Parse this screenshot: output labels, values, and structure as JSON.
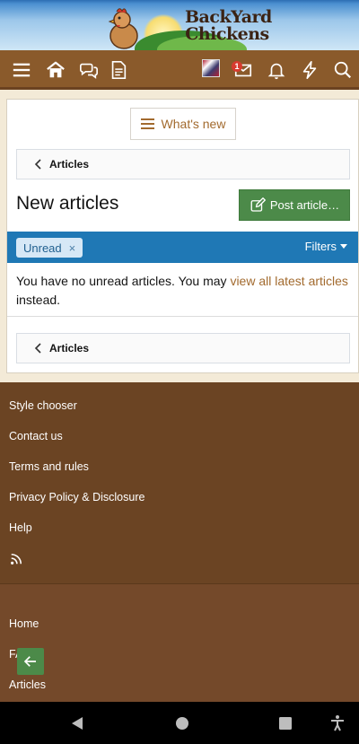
{
  "header": {
    "logo_line1": "BackYard",
    "logo_line2": "Chickens"
  },
  "navbar": {
    "icons": [
      "menu-icon",
      "home-icon",
      "chat-bubbles-icon",
      "document-icon",
      "avatar",
      "inbox-icon",
      "bell-icon",
      "bolt-icon",
      "search-icon"
    ],
    "inbox_badge": "1"
  },
  "main": {
    "whats_new_label": "What's new",
    "breadcrumb_top": "Articles",
    "page_title": "New articles",
    "post_button_label": "Post article…",
    "filter_chip_label": "Unread",
    "filter_chip_remove": "×",
    "filters_label": "Filters",
    "message_before": "You have no unread articles. You may ",
    "message_link": "view all latest articles",
    "message_after": " instead.",
    "breadcrumb_bottom": "Articles"
  },
  "footer": {
    "links": [
      "Style chooser",
      "Contact us",
      "Terms and rules",
      "Privacy Policy & Disclosure",
      "Help"
    ],
    "lower_links": [
      "Home",
      "FAQ's",
      "Articles"
    ]
  },
  "colors": {
    "navbar": "#8a5a2b",
    "accent_link": "#a26a2e",
    "post_button": "#4c8a49",
    "filter_bar": "#1f78b5",
    "footer": "#6b4423"
  }
}
